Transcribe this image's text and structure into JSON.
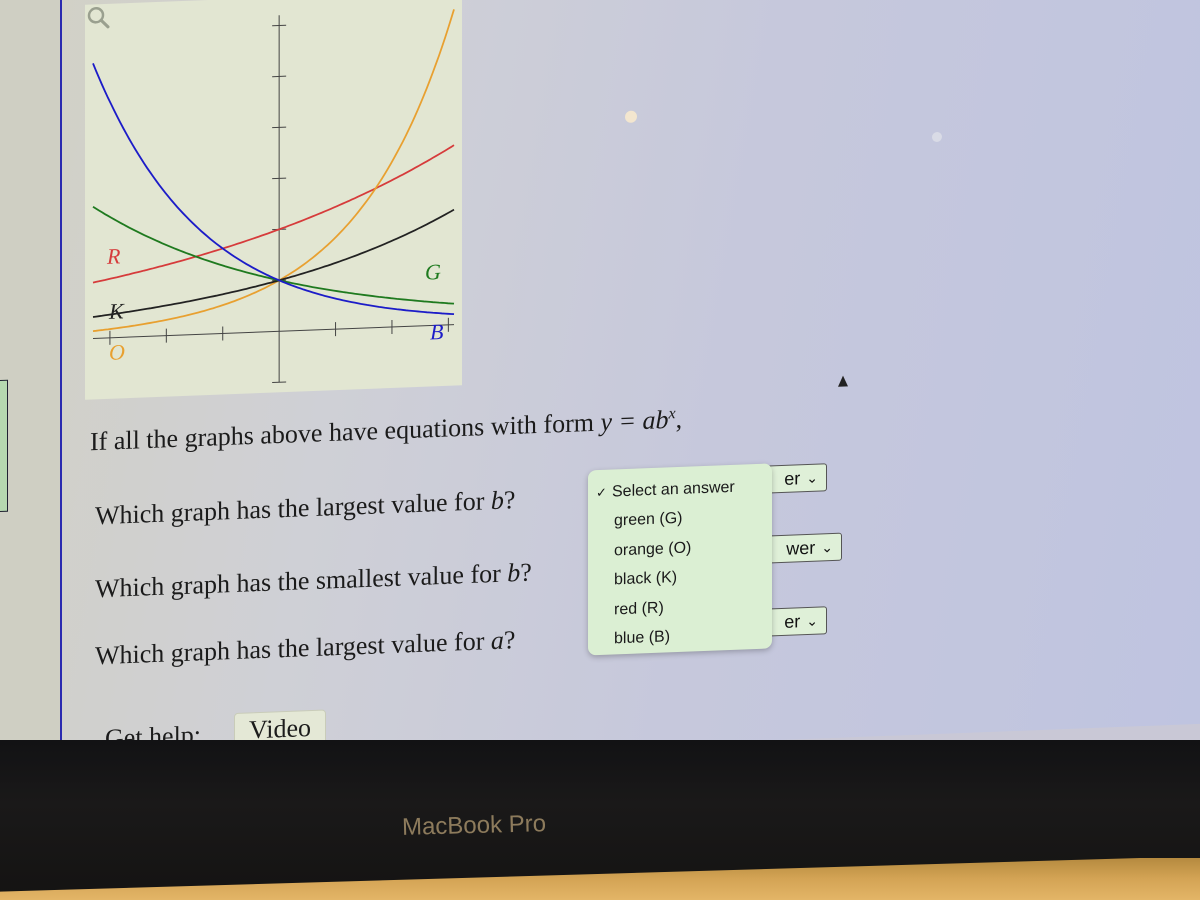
{
  "device": {
    "brand_label": "MacBook Pro"
  },
  "figure": {
    "curve_labels": [
      {
        "key": "R",
        "color": "#d63b3b"
      },
      {
        "key": "K",
        "color": "#222222"
      },
      {
        "key": "O",
        "color": "#e8a030"
      },
      {
        "key": "G",
        "color": "#1f7a1f"
      },
      {
        "key": "B",
        "color": "#1c1cc8"
      }
    ],
    "zoom_icon": "magnifier-icon"
  },
  "chart_data": {
    "type": "line",
    "title": "",
    "xlabel": "",
    "ylabel": "",
    "xlim": [
      -3.3,
      3.1
    ],
    "ylim": [
      -1,
      6.2
    ],
    "x_ticks": [
      -3,
      -2,
      -1,
      1,
      2,
      3
    ],
    "y_ticks": [
      -1,
      1,
      2,
      3,
      4,
      5,
      6
    ],
    "tick_labels_shown": false,
    "grid": false,
    "legend": "inline curve labels",
    "series": [
      {
        "name": "R",
        "color_name": "red",
        "color": "#d63b3b",
        "a": 2,
        "b": 1.2,
        "points": [
          [
            -3.3,
            1.09
          ],
          [
            -2,
            1.39
          ],
          [
            -1,
            1.67
          ],
          [
            0,
            2.0
          ],
          [
            1,
            2.4
          ],
          [
            2,
            2.88
          ],
          [
            3,
            3.46
          ]
        ]
      },
      {
        "name": "O",
        "color_name": "orange",
        "color": "#e8a030",
        "a": 1,
        "b": 1.8,
        "points": [
          [
            -3.3,
            0.14
          ],
          [
            -2,
            0.31
          ],
          [
            -1,
            0.56
          ],
          [
            0,
            1.0
          ],
          [
            1,
            1.8
          ],
          [
            2,
            3.24
          ],
          [
            3,
            5.83
          ]
        ]
      },
      {
        "name": "K",
        "color_name": "black",
        "color": "#222222",
        "a": 1,
        "b": 1.3,
        "points": [
          [
            -3.3,
            0.42
          ],
          [
            -2,
            0.59
          ],
          [
            -1,
            0.77
          ],
          [
            0,
            1.0
          ],
          [
            1,
            1.3
          ],
          [
            2,
            1.69
          ],
          [
            3,
            2.2
          ]
        ]
      },
      {
        "name": "G",
        "color_name": "green",
        "color": "#1f7a1f",
        "a": 1,
        "b": 0.75,
        "points": [
          [
            -3.3,
            2.58
          ],
          [
            -2,
            1.78
          ],
          [
            -1,
            1.33
          ],
          [
            0,
            1.0
          ],
          [
            1,
            0.75
          ],
          [
            2,
            0.56
          ],
          [
            3,
            0.42
          ]
        ]
      },
      {
        "name": "B",
        "color_name": "blue",
        "color": "#1c1cc8",
        "a": 1,
        "b": 0.6,
        "points": [
          [
            -3.3,
            5.4
          ],
          [
            -2,
            2.78
          ],
          [
            -1,
            1.67
          ],
          [
            0,
            1.0
          ],
          [
            1,
            0.6
          ],
          [
            2,
            0.36
          ],
          [
            3,
            0.22
          ]
        ]
      }
    ]
  },
  "prompt": {
    "lead": "If all the graphs above have equations with form ",
    "equation": "y = ab",
    "exponent": "x",
    "trail": ","
  },
  "questions": [
    {
      "text": "Which graph has the largest value for ",
      "var": "b",
      "end": "?",
      "select_visible": "er"
    },
    {
      "text": "Which graph has the smallest value for ",
      "var": "b",
      "end": "?",
      "select_visible": "wer"
    },
    {
      "text": "Which graph has the largest value for ",
      "var": "a",
      "end": "?",
      "select_visible": "er"
    }
  ],
  "dropdown": {
    "open_for_question": 1,
    "selected": "Select an answer",
    "options": [
      {
        "label": "Select an answer",
        "checked": true
      },
      {
        "label": "green (G)",
        "checked": false
      },
      {
        "label": "orange (O)",
        "checked": false
      },
      {
        "label": "black (K)",
        "checked": false
      },
      {
        "label": "red (R)",
        "checked": false
      },
      {
        "label": "blue (B)",
        "checked": false
      }
    ],
    "check_glyph": "✓",
    "chevron_glyph": "⌄"
  },
  "help": {
    "label": "Get help:",
    "video_button": "Video"
  }
}
